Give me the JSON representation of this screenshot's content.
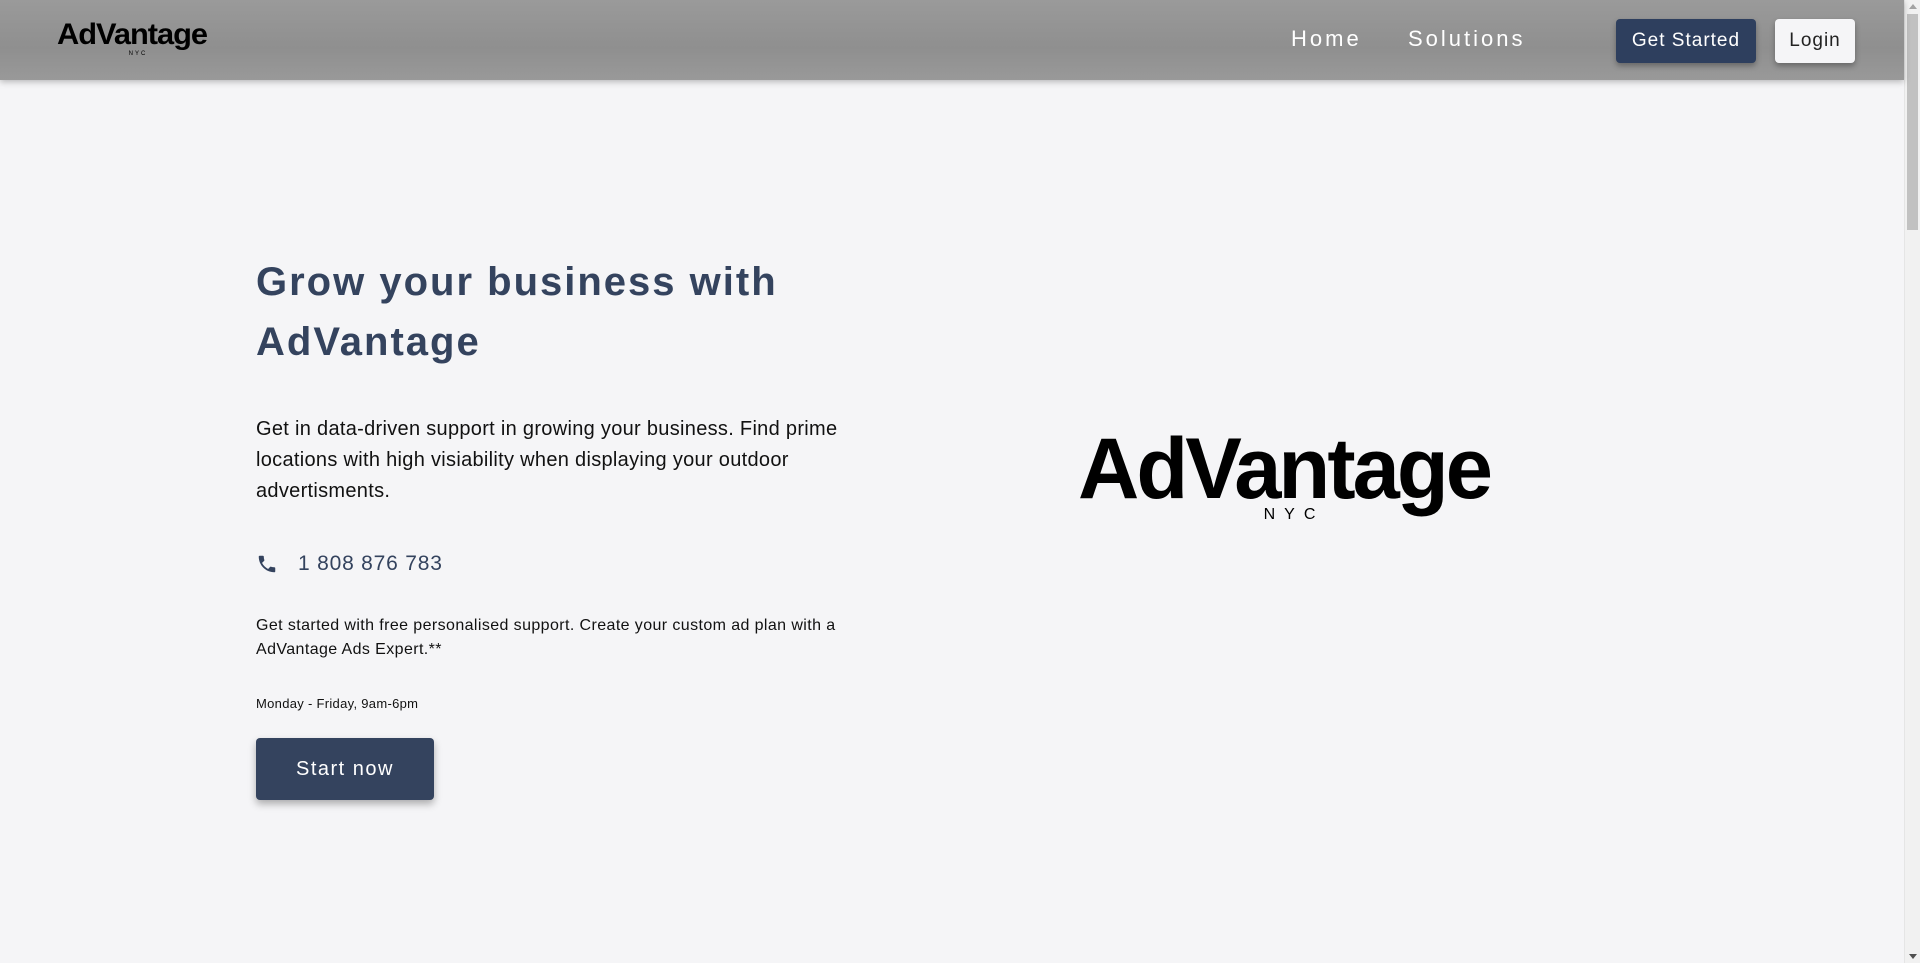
{
  "brand": {
    "logo_text": "AdVantage",
    "logo_subtext": "NYC"
  },
  "nav": {
    "links": [
      "Home",
      "Solutions"
    ],
    "get_started_label": "Get Started",
    "login_label": "Login"
  },
  "hero": {
    "title": "Grow your business with AdVantage",
    "description": "Get in data-driven support in growing your business. Find prime locations with high visiability when displaying your outdoor advertisments.",
    "phone": "1 808 876 783",
    "support_text": "Get started with free personalised support. Create your custom ad plan with a AdVantage Ads Expert.**",
    "hours": "Monday - Friday, 9am-6pm",
    "cta_label": "Start now"
  },
  "colors": {
    "accent": "#34435e",
    "header_bg": "#959595",
    "page_bg": "#f5f5f7"
  },
  "icons": {
    "phone": "phone-icon"
  }
}
